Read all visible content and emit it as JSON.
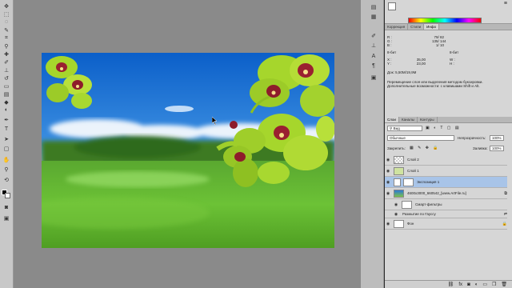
{
  "colors": {
    "toolbar_bg": "#c8c8c8",
    "workspace_bg": "#8a8a8a",
    "panel_bg": "#d6d6d6",
    "layer_selected": "#a8c4e8"
  },
  "panels_top": {
    "tabs": [
      "Коррекция",
      "Стили",
      "Инфо"
    ],
    "active_tab": "Инфо"
  },
  "info": {
    "rgb_labels": [
      "R :",
      "G :",
      "B :"
    ],
    "rgb_values_1": [
      "79/",
      "135/",
      "1/"
    ],
    "rgb_values_2": [
      "82",
      "144",
      "10"
    ],
    "bit_label_1": "8-бит",
    "bit_label_2": "8-бит",
    "x_label": "X :",
    "y_label": "Y :",
    "x_value": "35,00",
    "y_value": "23,00",
    "w_label": "W :",
    "h_label": "H :",
    "doc_size": "Док: 5,50M/19,9M",
    "hint_1": "Перемещение слоя или выделения методом буксировки.",
    "hint_2": "Дополнительные возможности: с клавишами Shift и Alt."
  },
  "layers_panel": {
    "tabs": [
      "Слои",
      "Каналы",
      "Контуры"
    ],
    "active_tab": "Слои",
    "kind_label": "Вид",
    "blend_mode": "Обычные",
    "opacity_label": "Непрозрачность:",
    "opacity_value": "100%",
    "lock_label": "Закрепить:",
    "fill_label": "Заливка:",
    "fill_value": "100%",
    "layers": [
      {
        "name": "Слой 2"
      },
      {
        "name": "Слой 1"
      },
      {
        "name": "Экспозиция 1"
      },
      {
        "name": "4600x3000_660542_[www.ArtFile.ru]"
      },
      {
        "name": "Смарт-фильтры"
      },
      {
        "name": "Размытие по Гауссу"
      },
      {
        "name": "Фон"
      }
    ]
  },
  "bottom_icons": [
    "link-icon",
    "fx-icon",
    "mask-icon",
    "adjustment-icon",
    "folder-icon",
    "new-layer-icon",
    "trash-icon"
  ]
}
